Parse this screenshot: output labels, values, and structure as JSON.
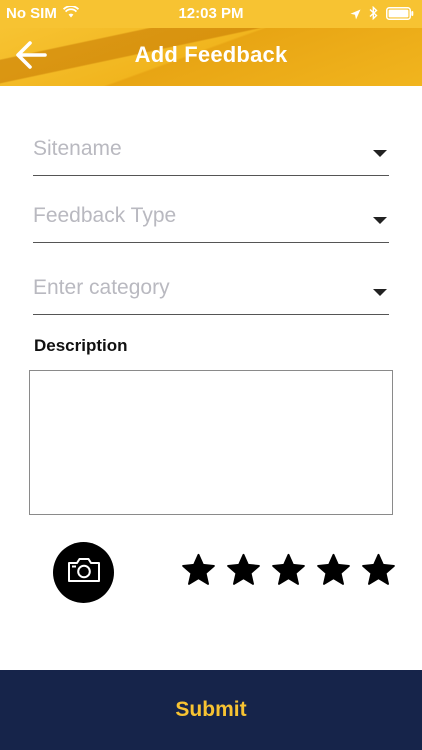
{
  "status_bar": {
    "carrier": "No SIM",
    "time": "12:03 PM"
  },
  "header": {
    "title": "Add Feedback"
  },
  "form": {
    "sitename_placeholder": "Sitename",
    "feedback_type_placeholder": "Feedback Type",
    "category_placeholder": "Enter category",
    "description_label": "Description",
    "description_value": ""
  },
  "rating": {
    "max": 5,
    "value": 5
  },
  "footer": {
    "submit_label": "Submit"
  },
  "colors": {
    "header": "#f7c332",
    "footer": "#16244a",
    "submit_text": "#f7c332"
  },
  "icons": {
    "back": "arrow-left-icon",
    "dropdown": "caret-down-icon",
    "camera": "camera-icon",
    "star": "star-icon",
    "wifi": "wifi-icon",
    "location": "location-arrow-icon",
    "bluetooth": "bluetooth-icon",
    "battery": "battery-icon"
  }
}
